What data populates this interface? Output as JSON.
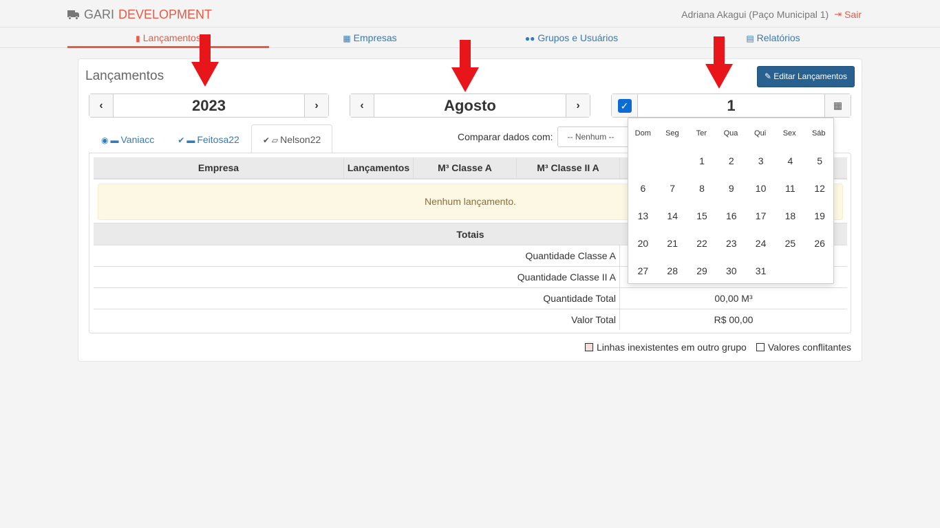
{
  "header": {
    "brand_first": "GARI",
    "brand_second": "DEVELOPMENT",
    "user": "Adriana Akagui (Paço Municipal 1)",
    "logout": "Sair"
  },
  "nav": {
    "items": [
      {
        "label": "Lançamentos",
        "icon": "book-icon"
      },
      {
        "label": "Empresas",
        "icon": "building-icon"
      },
      {
        "label": "Grupos e Usuários",
        "icon": "users-icon"
      },
      {
        "label": "Relatórios",
        "icon": "file-text-icon"
      }
    ]
  },
  "panel": {
    "title": "Lançamentos",
    "edit_button": "Editar Lançamentos",
    "year": "2023",
    "month": "Agosto",
    "day": "1",
    "day_enabled": true
  },
  "tabs": [
    {
      "label": "Vaniacc"
    },
    {
      "label": "Feitosa22"
    },
    {
      "label": "Nelson22"
    }
  ],
  "compare": {
    "label": "Comparar dados com:",
    "selected": "-- Nenhum --"
  },
  "table": {
    "columns": [
      "Empresa",
      "Lançamentos",
      "M³ Classe A",
      "M³ Classe II A"
    ],
    "empty_message": "Nenhum lançamento.",
    "totals_title": "Totais",
    "totals": [
      {
        "label": "Quantidade Classe A",
        "value": ""
      },
      {
        "label": "Quantidade Classe II A",
        "value": ""
      },
      {
        "label": "Quantidade Total",
        "value": "00,00 M³"
      },
      {
        "label": "Valor Total",
        "value": "R$ 00,00"
      }
    ]
  },
  "legend": {
    "missing_lines": "Linhas inexistentes em outro grupo",
    "conflicts": "Valores conflitantes",
    "missing_color": "#f2dede",
    "conflict_color": "#ffffff"
  },
  "datepicker": {
    "weekdays": [
      "Dom",
      "Seg",
      "Ter",
      "Qua",
      "Qui",
      "Sex",
      "Sáb"
    ],
    "leading_blanks": 2,
    "days": [
      "1",
      "2",
      "3",
      "4",
      "5",
      "6",
      "7",
      "8",
      "9",
      "10",
      "11",
      "12",
      "13",
      "14",
      "15",
      "16",
      "17",
      "18",
      "19",
      "20",
      "21",
      "22",
      "23",
      "24",
      "25",
      "26",
      "27",
      "28",
      "29",
      "30",
      "31"
    ]
  },
  "colors": {
    "accent": "#e95a43",
    "link": "#337ab7",
    "primary_button": "#286090",
    "arrow": "#e8151a"
  }
}
